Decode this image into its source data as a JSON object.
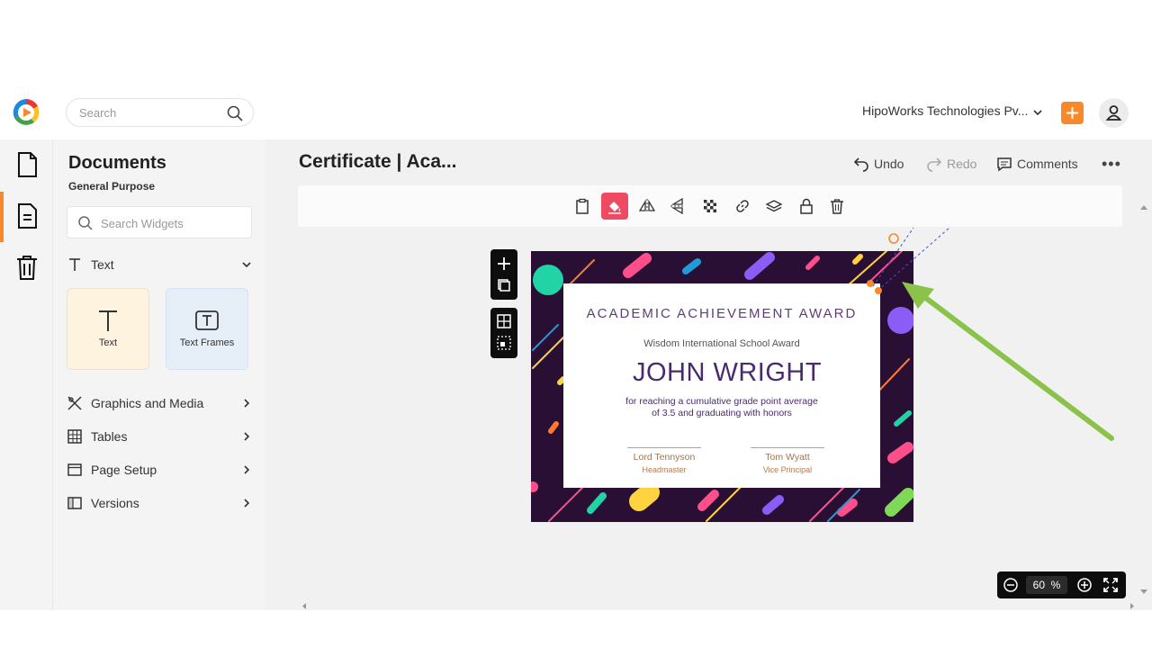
{
  "header": {
    "search_placeholder": "Search",
    "org_name": "HipoWorks Technologies Pv...",
    "accent_color": "#f7892a"
  },
  "panel": {
    "title": "Documents",
    "subtitle": "General Purpose",
    "search_placeholder": "Search Widgets",
    "text_section": "Text",
    "cards": [
      {
        "label": "Text"
      },
      {
        "label": "Text Frames"
      }
    ],
    "sections": [
      {
        "label": "Graphics and Media"
      },
      {
        "label": "Tables"
      },
      {
        "label": "Page Setup"
      },
      {
        "label": "Versions"
      }
    ]
  },
  "document": {
    "title": "Certificate | Aca...",
    "undo_label": "Undo",
    "redo_label": "Redo",
    "comments_label": "Comments",
    "more_label": "•••"
  },
  "toolbar": {
    "tools": [
      "clipboard-icon",
      "fill-icon",
      "flip-horizontal-icon",
      "flip-vertical-icon",
      "transparency-icon",
      "link-icon",
      "layers-icon",
      "lock-icon",
      "delete-icon"
    ],
    "active_tool": "fill-icon",
    "active_color": "#ee4a62"
  },
  "certificate": {
    "award_title": "ACADEMIC ACHIEVEMENT AWARD",
    "school": "Wisdom International School Award",
    "recipient": "JOHN WRIGHT",
    "reason_line1": "for reaching a cumulative grade point average",
    "reason_line2": "of 3.5 and graduating with honors",
    "signers": [
      {
        "name": "Lord Tennyson",
        "role": "Headmaster"
      },
      {
        "name": "Tom Wyatt",
        "role": "Vice Principal"
      }
    ],
    "background_color": "#2a0f34"
  },
  "zoom": {
    "value": "60",
    "unit": "%"
  }
}
